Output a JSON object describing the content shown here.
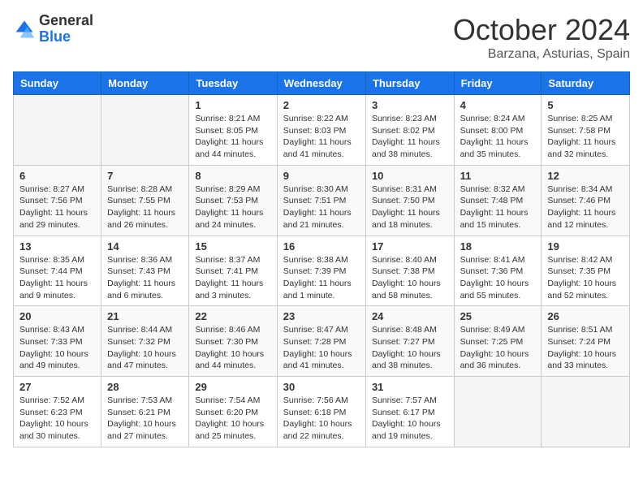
{
  "logo": {
    "general": "General",
    "blue": "Blue"
  },
  "title": "October 2024",
  "location": "Barzana, Asturias, Spain",
  "headers": [
    "Sunday",
    "Monday",
    "Tuesday",
    "Wednesday",
    "Thursday",
    "Friday",
    "Saturday"
  ],
  "weeks": [
    [
      {
        "day": "",
        "sunrise": "",
        "sunset": "",
        "daylight": ""
      },
      {
        "day": "",
        "sunrise": "",
        "sunset": "",
        "daylight": ""
      },
      {
        "day": "1",
        "sunrise": "Sunrise: 8:21 AM",
        "sunset": "Sunset: 8:05 PM",
        "daylight": "Daylight: 11 hours and 44 minutes."
      },
      {
        "day": "2",
        "sunrise": "Sunrise: 8:22 AM",
        "sunset": "Sunset: 8:03 PM",
        "daylight": "Daylight: 11 hours and 41 minutes."
      },
      {
        "day": "3",
        "sunrise": "Sunrise: 8:23 AM",
        "sunset": "Sunset: 8:02 PM",
        "daylight": "Daylight: 11 hours and 38 minutes."
      },
      {
        "day": "4",
        "sunrise": "Sunrise: 8:24 AM",
        "sunset": "Sunset: 8:00 PM",
        "daylight": "Daylight: 11 hours and 35 minutes."
      },
      {
        "day": "5",
        "sunrise": "Sunrise: 8:25 AM",
        "sunset": "Sunset: 7:58 PM",
        "daylight": "Daylight: 11 hours and 32 minutes."
      }
    ],
    [
      {
        "day": "6",
        "sunrise": "Sunrise: 8:27 AM",
        "sunset": "Sunset: 7:56 PM",
        "daylight": "Daylight: 11 hours and 29 minutes."
      },
      {
        "day": "7",
        "sunrise": "Sunrise: 8:28 AM",
        "sunset": "Sunset: 7:55 PM",
        "daylight": "Daylight: 11 hours and 26 minutes."
      },
      {
        "day": "8",
        "sunrise": "Sunrise: 8:29 AM",
        "sunset": "Sunset: 7:53 PM",
        "daylight": "Daylight: 11 hours and 24 minutes."
      },
      {
        "day": "9",
        "sunrise": "Sunrise: 8:30 AM",
        "sunset": "Sunset: 7:51 PM",
        "daylight": "Daylight: 11 hours and 21 minutes."
      },
      {
        "day": "10",
        "sunrise": "Sunrise: 8:31 AM",
        "sunset": "Sunset: 7:50 PM",
        "daylight": "Daylight: 11 hours and 18 minutes."
      },
      {
        "day": "11",
        "sunrise": "Sunrise: 8:32 AM",
        "sunset": "Sunset: 7:48 PM",
        "daylight": "Daylight: 11 hours and 15 minutes."
      },
      {
        "day": "12",
        "sunrise": "Sunrise: 8:34 AM",
        "sunset": "Sunset: 7:46 PM",
        "daylight": "Daylight: 11 hours and 12 minutes."
      }
    ],
    [
      {
        "day": "13",
        "sunrise": "Sunrise: 8:35 AM",
        "sunset": "Sunset: 7:44 PM",
        "daylight": "Daylight: 11 hours and 9 minutes."
      },
      {
        "day": "14",
        "sunrise": "Sunrise: 8:36 AM",
        "sunset": "Sunset: 7:43 PM",
        "daylight": "Daylight: 11 hours and 6 minutes."
      },
      {
        "day": "15",
        "sunrise": "Sunrise: 8:37 AM",
        "sunset": "Sunset: 7:41 PM",
        "daylight": "Daylight: 11 hours and 3 minutes."
      },
      {
        "day": "16",
        "sunrise": "Sunrise: 8:38 AM",
        "sunset": "Sunset: 7:39 PM",
        "daylight": "Daylight: 11 hours and 1 minute."
      },
      {
        "day": "17",
        "sunrise": "Sunrise: 8:40 AM",
        "sunset": "Sunset: 7:38 PM",
        "daylight": "Daylight: 10 hours and 58 minutes."
      },
      {
        "day": "18",
        "sunrise": "Sunrise: 8:41 AM",
        "sunset": "Sunset: 7:36 PM",
        "daylight": "Daylight: 10 hours and 55 minutes."
      },
      {
        "day": "19",
        "sunrise": "Sunrise: 8:42 AM",
        "sunset": "Sunset: 7:35 PM",
        "daylight": "Daylight: 10 hours and 52 minutes."
      }
    ],
    [
      {
        "day": "20",
        "sunrise": "Sunrise: 8:43 AM",
        "sunset": "Sunset: 7:33 PM",
        "daylight": "Daylight: 10 hours and 49 minutes."
      },
      {
        "day": "21",
        "sunrise": "Sunrise: 8:44 AM",
        "sunset": "Sunset: 7:32 PM",
        "daylight": "Daylight: 10 hours and 47 minutes."
      },
      {
        "day": "22",
        "sunrise": "Sunrise: 8:46 AM",
        "sunset": "Sunset: 7:30 PM",
        "daylight": "Daylight: 10 hours and 44 minutes."
      },
      {
        "day": "23",
        "sunrise": "Sunrise: 8:47 AM",
        "sunset": "Sunset: 7:28 PM",
        "daylight": "Daylight: 10 hours and 41 minutes."
      },
      {
        "day": "24",
        "sunrise": "Sunrise: 8:48 AM",
        "sunset": "Sunset: 7:27 PM",
        "daylight": "Daylight: 10 hours and 38 minutes."
      },
      {
        "day": "25",
        "sunrise": "Sunrise: 8:49 AM",
        "sunset": "Sunset: 7:25 PM",
        "daylight": "Daylight: 10 hours and 36 minutes."
      },
      {
        "day": "26",
        "sunrise": "Sunrise: 8:51 AM",
        "sunset": "Sunset: 7:24 PM",
        "daylight": "Daylight: 10 hours and 33 minutes."
      }
    ],
    [
      {
        "day": "27",
        "sunrise": "Sunrise: 7:52 AM",
        "sunset": "Sunset: 6:23 PM",
        "daylight": "Daylight: 10 hours and 30 minutes."
      },
      {
        "day": "28",
        "sunrise": "Sunrise: 7:53 AM",
        "sunset": "Sunset: 6:21 PM",
        "daylight": "Daylight: 10 hours and 27 minutes."
      },
      {
        "day": "29",
        "sunrise": "Sunrise: 7:54 AM",
        "sunset": "Sunset: 6:20 PM",
        "daylight": "Daylight: 10 hours and 25 minutes."
      },
      {
        "day": "30",
        "sunrise": "Sunrise: 7:56 AM",
        "sunset": "Sunset: 6:18 PM",
        "daylight": "Daylight: 10 hours and 22 minutes."
      },
      {
        "day": "31",
        "sunrise": "Sunrise: 7:57 AM",
        "sunset": "Sunset: 6:17 PM",
        "daylight": "Daylight: 10 hours and 19 minutes."
      },
      {
        "day": "",
        "sunrise": "",
        "sunset": "",
        "daylight": ""
      },
      {
        "day": "",
        "sunrise": "",
        "sunset": "",
        "daylight": ""
      }
    ]
  ]
}
